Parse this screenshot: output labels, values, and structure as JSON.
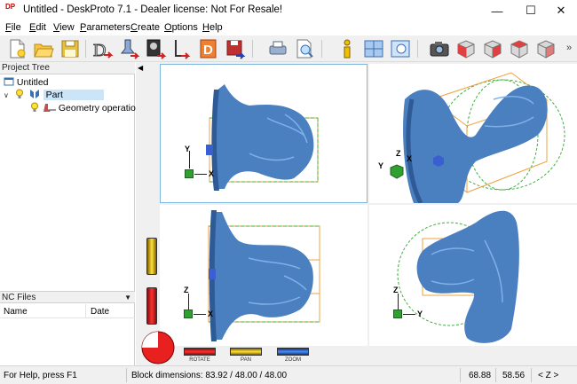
{
  "window": {
    "title": "Untitled - DeskProto 7.1 - Dealer license: Not For Resale!",
    "icon_text": "DP"
  },
  "menu": [
    {
      "label": "File",
      "mnemonic": "F"
    },
    {
      "label": "Edit",
      "mnemonic": "E"
    },
    {
      "label": "View",
      "mnemonic": "V"
    },
    {
      "label": "Parameters",
      "mnemonic": "P"
    },
    {
      "label": "Create",
      "mnemonic": "C"
    },
    {
      "label": "Options",
      "mnemonic": "O"
    },
    {
      "label": "Help",
      "mnemonic": "H"
    }
  ],
  "toolbar": {
    "overflow_label": "»",
    "icons": [
      "new-file-icon",
      "open-folder-icon",
      "save-icon",
      "define-part-icon",
      "define-operation-icon",
      "define-bitmap-icon",
      "define-vector-icon",
      "define-design-icon",
      "save-nc-icon",
      "print-icon",
      "print-preview-icon",
      "info-icon",
      "four-views-icon",
      "zoom-window-icon",
      "camera-icon",
      "view-cube-red-icon",
      "view-cube-front-icon",
      "view-cube-side-icon",
      "view-cube-iso-icon"
    ]
  },
  "project_tree": {
    "header": "Project Tree",
    "root": "Untitled",
    "part": "Part",
    "operation": "Geometry operation"
  },
  "nc_files": {
    "header": "NC Files",
    "columns": [
      "Name",
      "Date"
    ]
  },
  "viewports": {
    "top_left_axes": [
      "Y",
      "X"
    ],
    "top_right_axes": [
      "Z",
      "Y",
      "X"
    ],
    "bottom_left_axes": [
      "Z",
      "X"
    ],
    "bottom_right_axes": [
      "Z",
      "Y"
    ]
  },
  "view_controls": {
    "rotate": "ROTATE",
    "pan": "PAN",
    "zoom": "ZOOM"
  },
  "status": {
    "help": "For Help, press F1",
    "block_dimensions": "Block dimensions: 83.92 / 48.00 / 48.00",
    "value1": "68.88",
    "value2": "58.56",
    "axis": "< Z >"
  },
  "colors": {
    "model_blue": "#4a7fc0",
    "bbox_orange": "#f0a040",
    "sphere_green": "#40b040",
    "selection_blue": "#7fb6e0"
  }
}
